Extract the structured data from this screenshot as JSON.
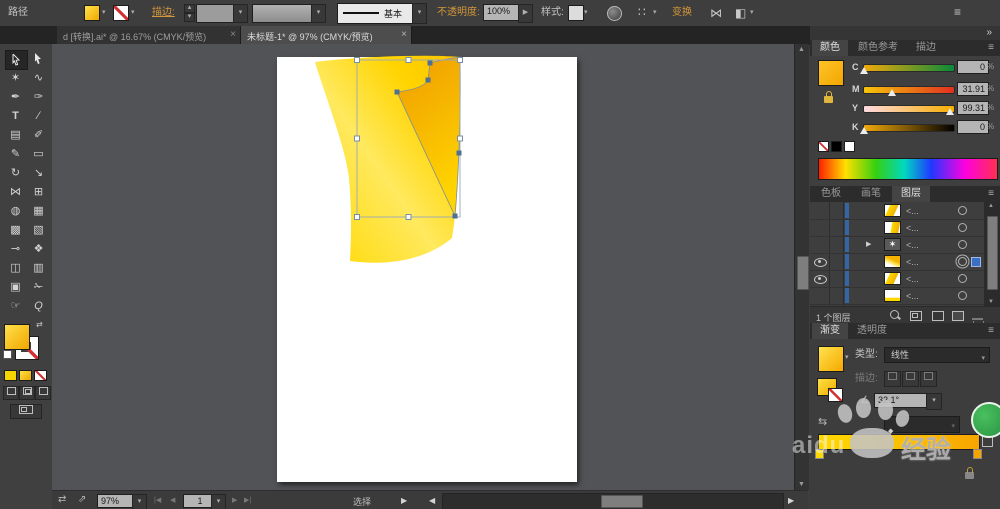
{
  "controlBar": {
    "context_label": "路径",
    "stroke_label": "描边:",
    "brush_value": "基本",
    "opacity_label": "不透明度:",
    "opacity_value": "100%",
    "style_label": "样式:",
    "transform_label": "变换"
  },
  "tabs": [
    {
      "title": "d [转换].ai* @ 16.67% (CMYK/预览)"
    },
    {
      "title": "未标题-1* @ 97% (CMYK/预览)"
    }
  ],
  "icons": {
    "close": "×",
    "dropdown": "▾",
    "spin_up": "▴",
    "spin_down": "▾",
    "collapse": "»",
    "panel_menu": "≡",
    "play": "▶",
    "first": "|◀",
    "prev": "◀",
    "next": "▶",
    "last": "▶|",
    "scroll_up": "▲",
    "scroll_down": "▼",
    "scroll_left": "◀",
    "scroll_right": "▶",
    "swap": "⇄",
    "export": "⇗",
    "dots": "∷",
    "align": "⋈",
    "distribute": "◧",
    "reverse": "⇆",
    "angle": "∠",
    "diamond": "◆",
    "expand": "▶",
    "star": "✶"
  },
  "toolbar": {
    "glyphs": {
      "wand": "✶",
      "lasso": "∿",
      "pen": "✒",
      "curvature": "✑",
      "type": "T",
      "line": "∕",
      "rectgrid": "▤",
      "brush": "✐",
      "pencil": "✎",
      "eraser": "▭",
      "rotate": "↻",
      "scale": "↘",
      "width": "⋈",
      "freetransform": "⊞",
      "shapebuilder": "◍",
      "perspective": "▦",
      "mesh": "▩",
      "gradient": "▧",
      "eyedropper": "⊸",
      "blend": "❖",
      "symbolspray": "◫",
      "graph": "▥",
      "artboard": "▣",
      "slice": "✁",
      "hand": "☞",
      "zoom": "Q"
    }
  },
  "colorPanel": {
    "tabs": [
      "颜色",
      "颜色参考",
      "描边"
    ],
    "channels": [
      {
        "label": "C",
        "value": "0"
      },
      {
        "label": "M",
        "value": "31.91"
      },
      {
        "label": "Y",
        "value": "99.31"
      },
      {
        "label": "K",
        "value": "0"
      }
    ],
    "percent": "%"
  },
  "layersPanel": {
    "tabs": [
      "色板",
      "画笔",
      "图层"
    ],
    "rows": [
      {
        "label": "<..."
      },
      {
        "label": "<..."
      },
      {
        "label": "<..."
      },
      {
        "label": "<..."
      },
      {
        "label": "<..."
      },
      {
        "label": "<..."
      }
    ],
    "status": "1 个图层"
  },
  "gradientPanel": {
    "tabs": [
      "渐变",
      "透明度"
    ],
    "type_label": "类型:",
    "type_value": "线性",
    "stroke_label": "描边:",
    "angle_value": "32.1°"
  },
  "statusBar": {
    "zoom": "97%",
    "artboard": "1",
    "tool": "选择"
  },
  "watermark": {
    "partial": "aidu",
    "text": "经验"
  },
  "colors": {
    "accent_yellow": "#f6b100",
    "selection_blue": "#3b6fc4",
    "link_orange": "#d4973b"
  }
}
